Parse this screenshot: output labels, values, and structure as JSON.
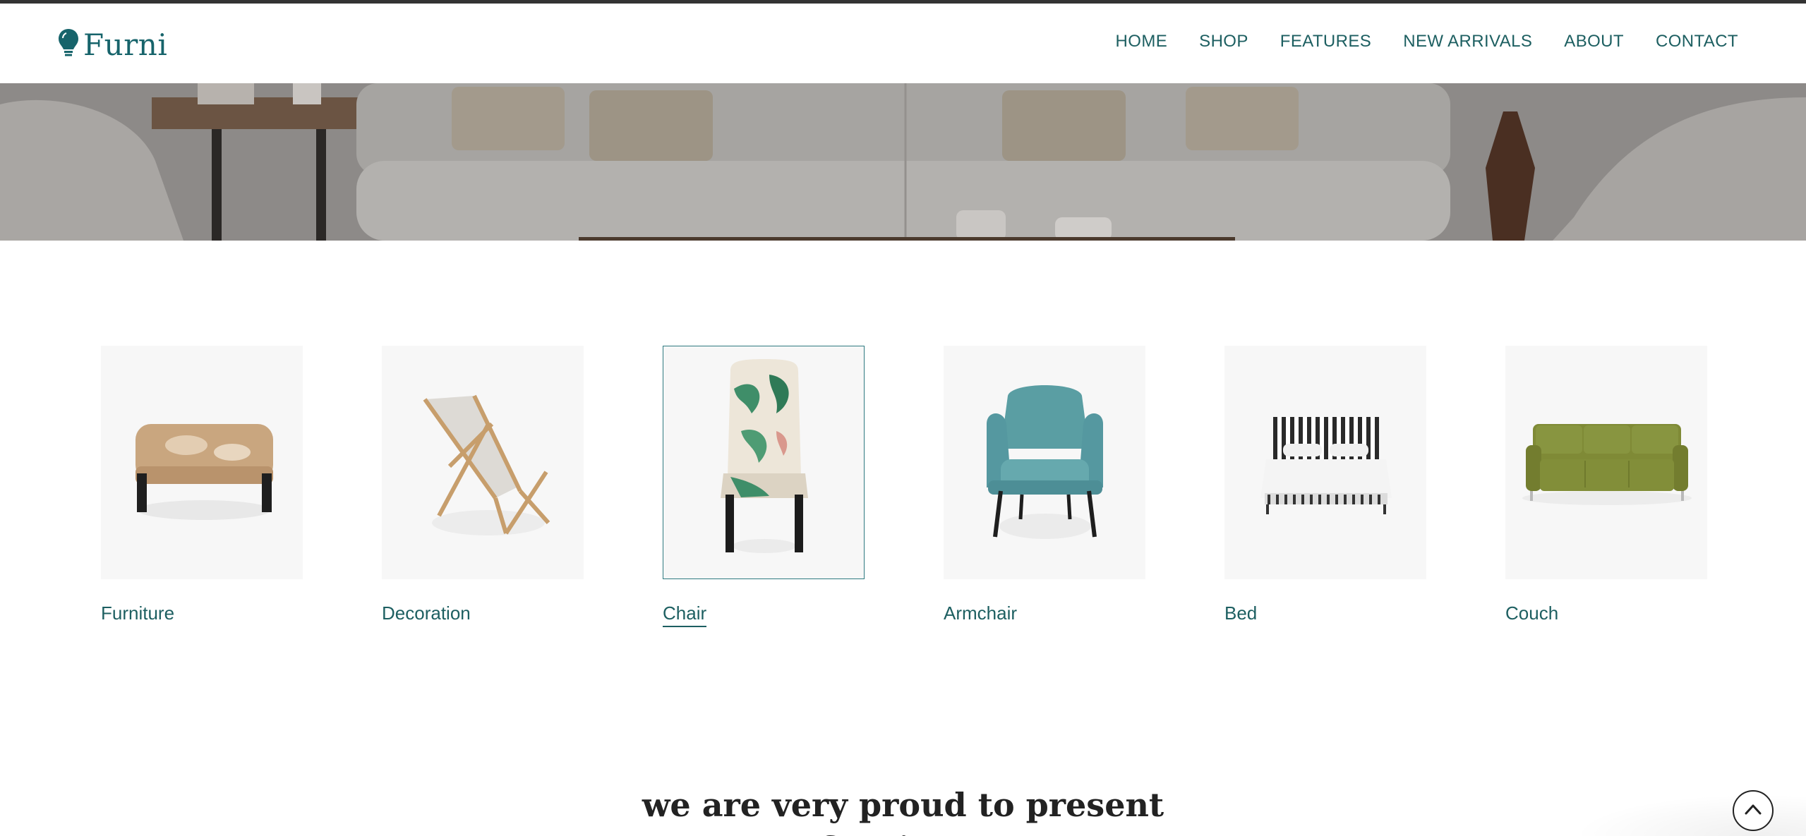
{
  "brand": {
    "name": "Furni",
    "logo_icon": "bulb-icon",
    "color": "#17646b"
  },
  "nav": {
    "items": [
      {
        "label": "HOME"
      },
      {
        "label": "SHOP"
      },
      {
        "label": "FEATURES"
      },
      {
        "label": "NEW ARRIVALS"
      },
      {
        "label": "ABOUT"
      },
      {
        "label": "CONTACT"
      }
    ]
  },
  "categories": [
    {
      "label": "Furniture",
      "icon": "ottoman-image"
    },
    {
      "label": "Decoration",
      "icon": "deck-chair-image"
    },
    {
      "label": "Chair",
      "icon": "chair-image",
      "active": true
    },
    {
      "label": "Armchair",
      "icon": "armchair-image"
    },
    {
      "label": "Bed",
      "icon": "bed-image"
    },
    {
      "label": "Couch",
      "icon": "couch-image"
    }
  ],
  "section": {
    "title_line1": "we are very proud to present",
    "title_line2": "furniture"
  },
  "scroll_top": {
    "icon": "chevron-up-icon"
  }
}
